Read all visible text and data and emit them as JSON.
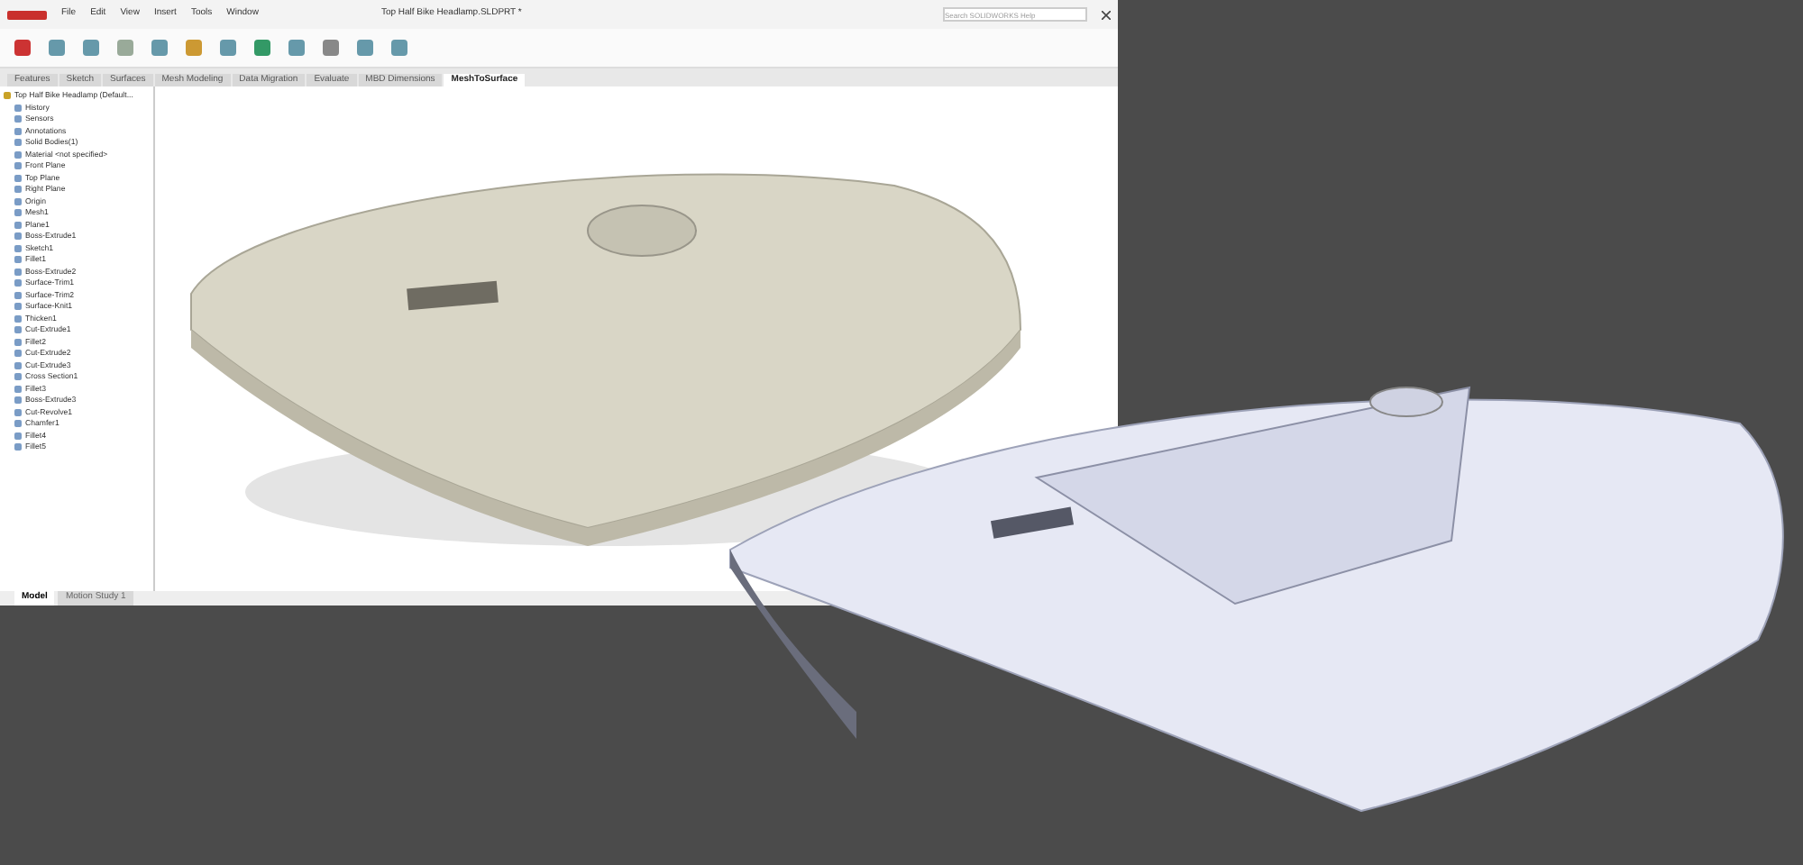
{
  "window": {
    "title": "Top Half Bike Headlamp.SLDPRT *",
    "search": {
      "placeholder": "Search SOLIDWORKS Help"
    }
  },
  "menu": [
    "File",
    "Edit",
    "View",
    "Insert",
    "Tools",
    "Window"
  ],
  "ribbon_tabs": [
    {
      "label": "Features",
      "selected": false
    },
    {
      "label": "Sketch",
      "selected": false
    },
    {
      "label": "Surfaces",
      "selected": false
    },
    {
      "label": "Mesh Modeling",
      "selected": false
    },
    {
      "label": "Data Migration",
      "selected": false
    },
    {
      "label": "Evaluate",
      "selected": false
    },
    {
      "label": "MBD Dimensions",
      "selected": false
    },
    {
      "label": "MeshToSurface",
      "selected": true
    }
  ],
  "tree": [
    {
      "label": "Top Half Bike Headlamp (Default...",
      "children": [
        {
          "label": "History"
        },
        {
          "label": "Sensors"
        },
        {
          "label": "Annotations"
        },
        {
          "label": "Solid Bodies(1)"
        },
        {
          "label": "Material <not specified>"
        },
        {
          "label": "Front Plane"
        },
        {
          "label": "Top Plane"
        },
        {
          "label": "Right Plane"
        },
        {
          "label": "Origin"
        },
        {
          "label": "Mesh1"
        },
        {
          "label": "Plane1"
        },
        {
          "label": "Boss-Extrude1"
        },
        {
          "label": "Sketch1"
        },
        {
          "label": "Fillet1"
        },
        {
          "label": "Boss-Extrude2"
        },
        {
          "label": "Surface-Trim1"
        },
        {
          "label": "Surface-Trim2"
        },
        {
          "label": "Surface-Knit1"
        },
        {
          "label": "Thicken1"
        },
        {
          "label": "Cut-Extrude1"
        },
        {
          "label": "Fillet2"
        },
        {
          "label": "Cut-Extrude2"
        },
        {
          "label": "Cut-Extrude3"
        },
        {
          "label": "Cross Section1"
        },
        {
          "label": "Fillet3"
        },
        {
          "label": "Boss-Extrude3"
        },
        {
          "label": "Cut-Revolve1"
        },
        {
          "label": "Chamfer1"
        },
        {
          "label": "Fillet4"
        },
        {
          "label": "Fillet5"
        }
      ]
    }
  ],
  "bottom_tabs": [
    {
      "label": "Model",
      "selected": true
    },
    {
      "label": "Motion Study 1",
      "selected": false
    }
  ]
}
